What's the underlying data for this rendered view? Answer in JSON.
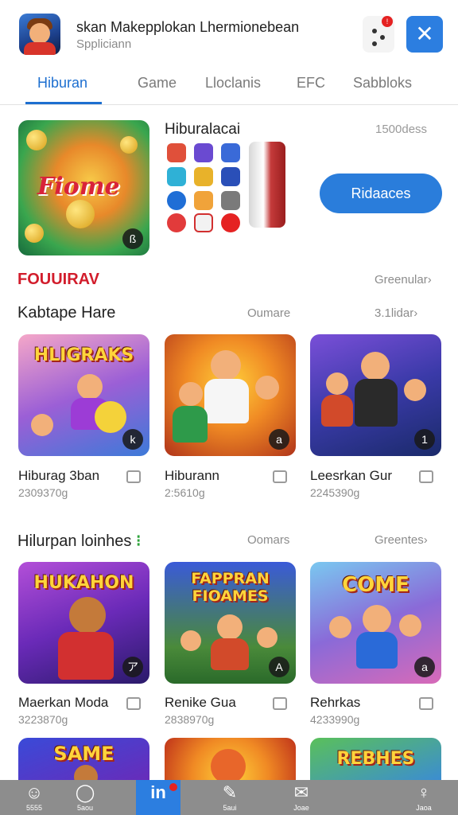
{
  "header": {
    "title": "skan Makepplokan Lhermionebean",
    "subtitle": "Sppliciann",
    "notif_badge": "!",
    "close_glyph": "✕"
  },
  "tabs": [
    {
      "label": "Hiburan",
      "active": true
    },
    {
      "label": "Game",
      "active": false
    },
    {
      "label": "Lloclanis",
      "active": false
    },
    {
      "label": "EFC",
      "active": false
    },
    {
      "label": "Sabbloks",
      "active": false
    }
  ],
  "featured": {
    "art_text": "Fiome",
    "corner_glyph": "ß",
    "title": "Hiburalacai",
    "meta": "1500dess",
    "install_label": "Ridaaces"
  },
  "sections": {
    "red_label": "FOUUIRAV",
    "red_see_more": "Greenular›",
    "row1": {
      "title": "Kabtape Hare",
      "mid": "Oumare",
      "see_more": "3.1lidar›"
    },
    "row2": {
      "title": "Hilurpan loinhes",
      "mid": "Oomars",
      "see_more": "Greentes›"
    }
  },
  "cards": [
    {
      "art": "HLIGRAKS",
      "corner": "k",
      "name": "Hiburag 3ban",
      "sub": "2309370g"
    },
    {
      "art": "",
      "corner": "a",
      "name": "Hiburann",
      "sub": "2:5610g"
    },
    {
      "art": "",
      "corner": "1",
      "name": "Leesrkan Gur",
      "sub": "2245390g"
    },
    {
      "art": "HUKAHON",
      "corner": "ア",
      "name": "Maerkan Moda",
      "sub": "3223870g"
    },
    {
      "art": "FAPPRAN FIOAMES",
      "corner": "A",
      "name": "Renike Gua",
      "sub": "2838970g"
    },
    {
      "art": "COME",
      "corner": "a",
      "name": "Rehrkas",
      "sub": "4233990g"
    },
    {
      "art": "SAME",
      "corner": "",
      "name": "",
      "sub": ""
    },
    {
      "art": "",
      "corner": "",
      "name": "",
      "sub": ""
    },
    {
      "art": "REBHES",
      "corner": "",
      "name": "",
      "sub": ""
    }
  ],
  "bottom_nav": [
    {
      "icon": "home-icon",
      "glyph": "☺",
      "label": "5555"
    },
    {
      "icon": "search-icon",
      "glyph": "◯",
      "label": "5aou"
    },
    {
      "icon": "apps-icon",
      "glyph": "in",
      "label": ""
    },
    {
      "icon": "chat-icon",
      "glyph": "✎",
      "label": "5aui"
    },
    {
      "icon": "mail-icon",
      "glyph": "✉",
      "label": "Joae"
    },
    {
      "icon": "profile-icon",
      "glyph": "♀",
      "label": "Jaoa"
    }
  ],
  "colors": {
    "accent": "#2c7ee0",
    "red_label": "#d21d2c",
    "nav_bg": "#8d8d8d"
  }
}
